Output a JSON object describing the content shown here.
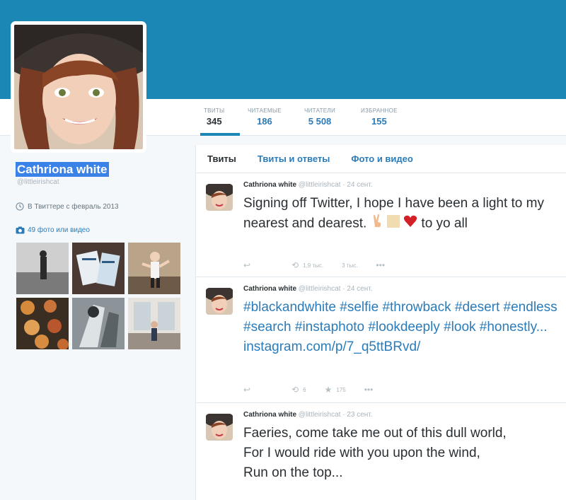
{
  "profile": {
    "name": "Cathriona white",
    "handle": "@littleirishcat",
    "joined": "В Твиттере с февраль 2013",
    "photos_link": "49 фото или видео"
  },
  "stats": [
    {
      "label": "ТВИТЫ",
      "value": "345"
    },
    {
      "label": "ЧИТАЕМЫЕ",
      "value": "186"
    },
    {
      "label": "ЧИТАТЕЛИ",
      "value": "5 508"
    },
    {
      "label": "ИЗБРАННОЕ",
      "value": "155"
    }
  ],
  "tabs": [
    "Твиты",
    "Твиты и ответы",
    "Фото и видео"
  ],
  "tweets": [
    {
      "name": "Cathriona white",
      "handle": "@littleirishcat",
      "date": "24 сент.",
      "text_before": "Signing off Twitter, I hope I have been a light to my nearest and dearest.",
      "text_after": "to yo all",
      "retweets": "1,9 тыс.",
      "favorites": "3 тыс."
    },
    {
      "name": "Cathriona white",
      "handle": "@littleirishcat",
      "date": "24 сент.",
      "hashtags": "#blackandwhite #selfie #throwback #desert #endless #search #instaphoto #lookdeeply #look #honestly...",
      "link": "instagram.com/p/7_q5ttBRvd/",
      "retweets": "6",
      "favorites": "175"
    },
    {
      "name": "Cathriona white",
      "handle": "@littleirishcat",
      "date": "23 сент.",
      "line1": "Faeries, come take me out of this dull world,",
      "line2": "For I would ride with you upon the wind,",
      "line3": "Run on the top..."
    }
  ],
  "colors": {
    "header": "#1b87b5",
    "link": "#2b7bb9",
    "name_highlight": "#3b82e8"
  },
  "icons": [
    "clock-icon",
    "camera-icon",
    "reply-icon",
    "retweet-icon",
    "star-icon",
    "more-icon",
    "victory-hand-emoji",
    "heart-emoji"
  ]
}
